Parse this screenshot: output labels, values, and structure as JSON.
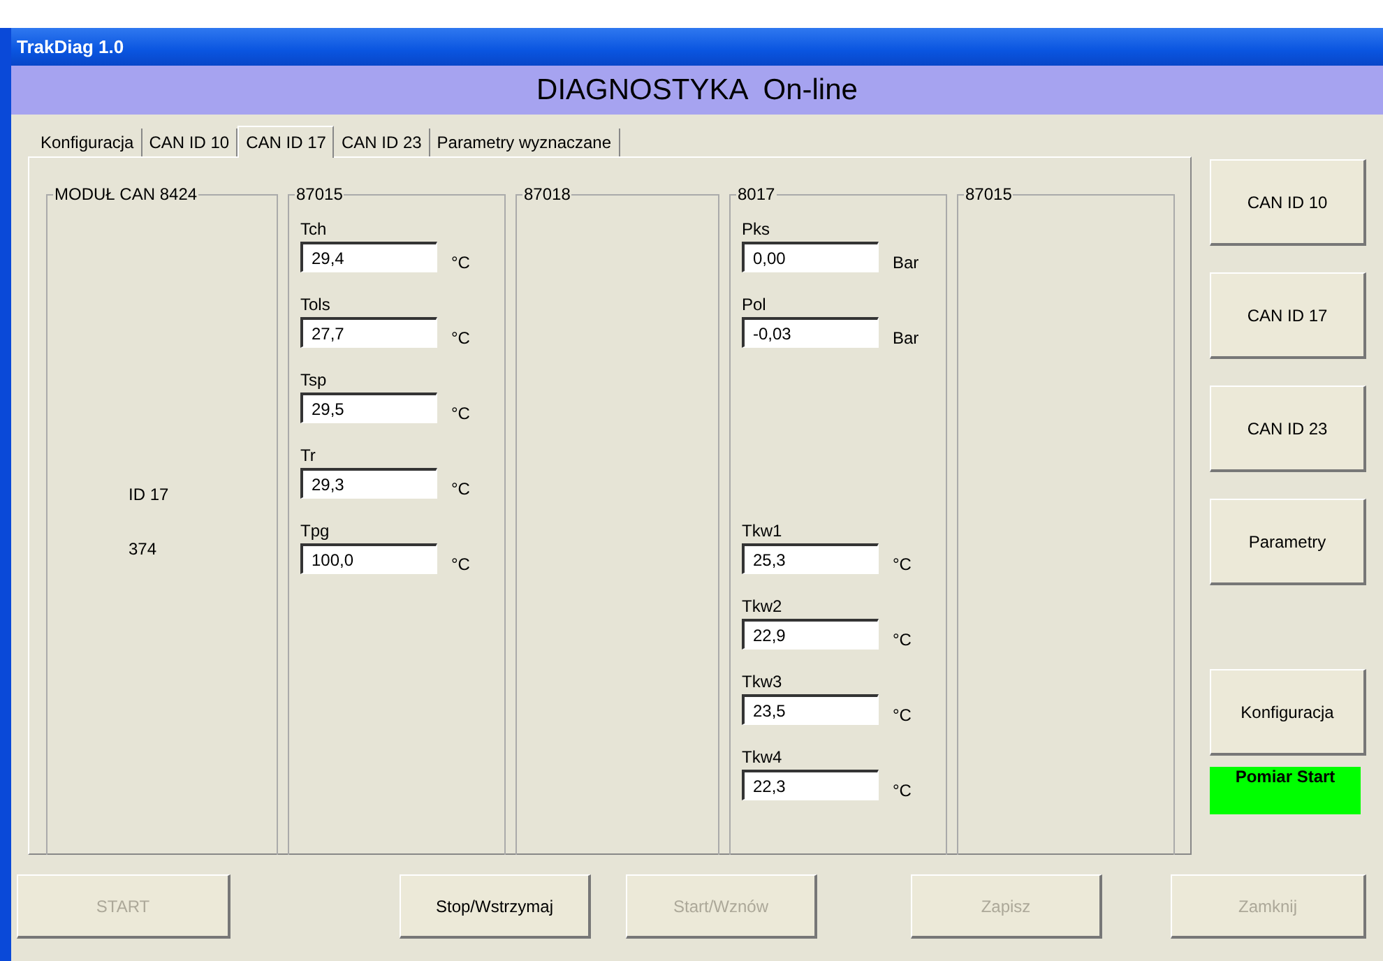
{
  "window": {
    "title": "TrakDiag 1.0"
  },
  "header": "DIAGNOSTYKA  On-line",
  "tabs": [
    {
      "label": "Konfiguracja",
      "selected": false
    },
    {
      "label": "CAN ID 10",
      "selected": false
    },
    {
      "label": "CAN ID 17",
      "selected": true
    },
    {
      "label": "CAN ID 23",
      "selected": false
    },
    {
      "label": "Parametry wyznaczane",
      "selected": false
    }
  ],
  "groups": [
    {
      "title": "MODUŁ CAN 8424",
      "lines": [
        "ID 17",
        "374"
      ]
    },
    {
      "title": "87015",
      "fields": [
        {
          "label": "Tch",
          "value": "29,4",
          "unit": "°C"
        },
        {
          "label": "Tols",
          "value": "27,7",
          "unit": "°C"
        },
        {
          "label": "Tsp",
          "value": "29,5",
          "unit": "°C"
        },
        {
          "label": "Tr",
          "value": "29,3",
          "unit": "°C"
        },
        {
          "label": "Tpg",
          "value": "100,0",
          "unit": "°C"
        }
      ]
    },
    {
      "title": "87018"
    },
    {
      "title": "8017",
      "fields": [
        {
          "label": "Pks",
          "value": "0,00",
          "unit": "Bar"
        },
        {
          "label": "Pol",
          "value": "-0,03",
          "unit": "Bar"
        }
      ],
      "lower_fields": [
        {
          "label": "Tkw1",
          "value": "25,3",
          "unit": "°C"
        },
        {
          "label": "Tkw2",
          "value": "22,9",
          "unit": "°C"
        },
        {
          "label": "Tkw3",
          "value": "23,5",
          "unit": "°C"
        },
        {
          "label": "Tkw4",
          "value": "22,3",
          "unit": "°C"
        }
      ]
    },
    {
      "title": "87015"
    }
  ],
  "side_buttons": [
    {
      "label": "CAN ID 10"
    },
    {
      "label": "CAN ID 17"
    },
    {
      "label": "CAN ID 23"
    },
    {
      "label": "Parametry"
    },
    {
      "label": "Konfiguracja"
    }
  ],
  "status_indicator": {
    "label": "Pomiar Start",
    "color": "#00ff00"
  },
  "bottom_buttons": [
    {
      "label": "START",
      "disabled": true
    },
    {
      "label": "Stop/Wstrzymaj",
      "disabled": false
    },
    {
      "label": "Start/Wznów",
      "disabled": true
    },
    {
      "label": "Zapisz",
      "disabled": true
    },
    {
      "label": "Zamknij",
      "disabled": true
    }
  ]
}
